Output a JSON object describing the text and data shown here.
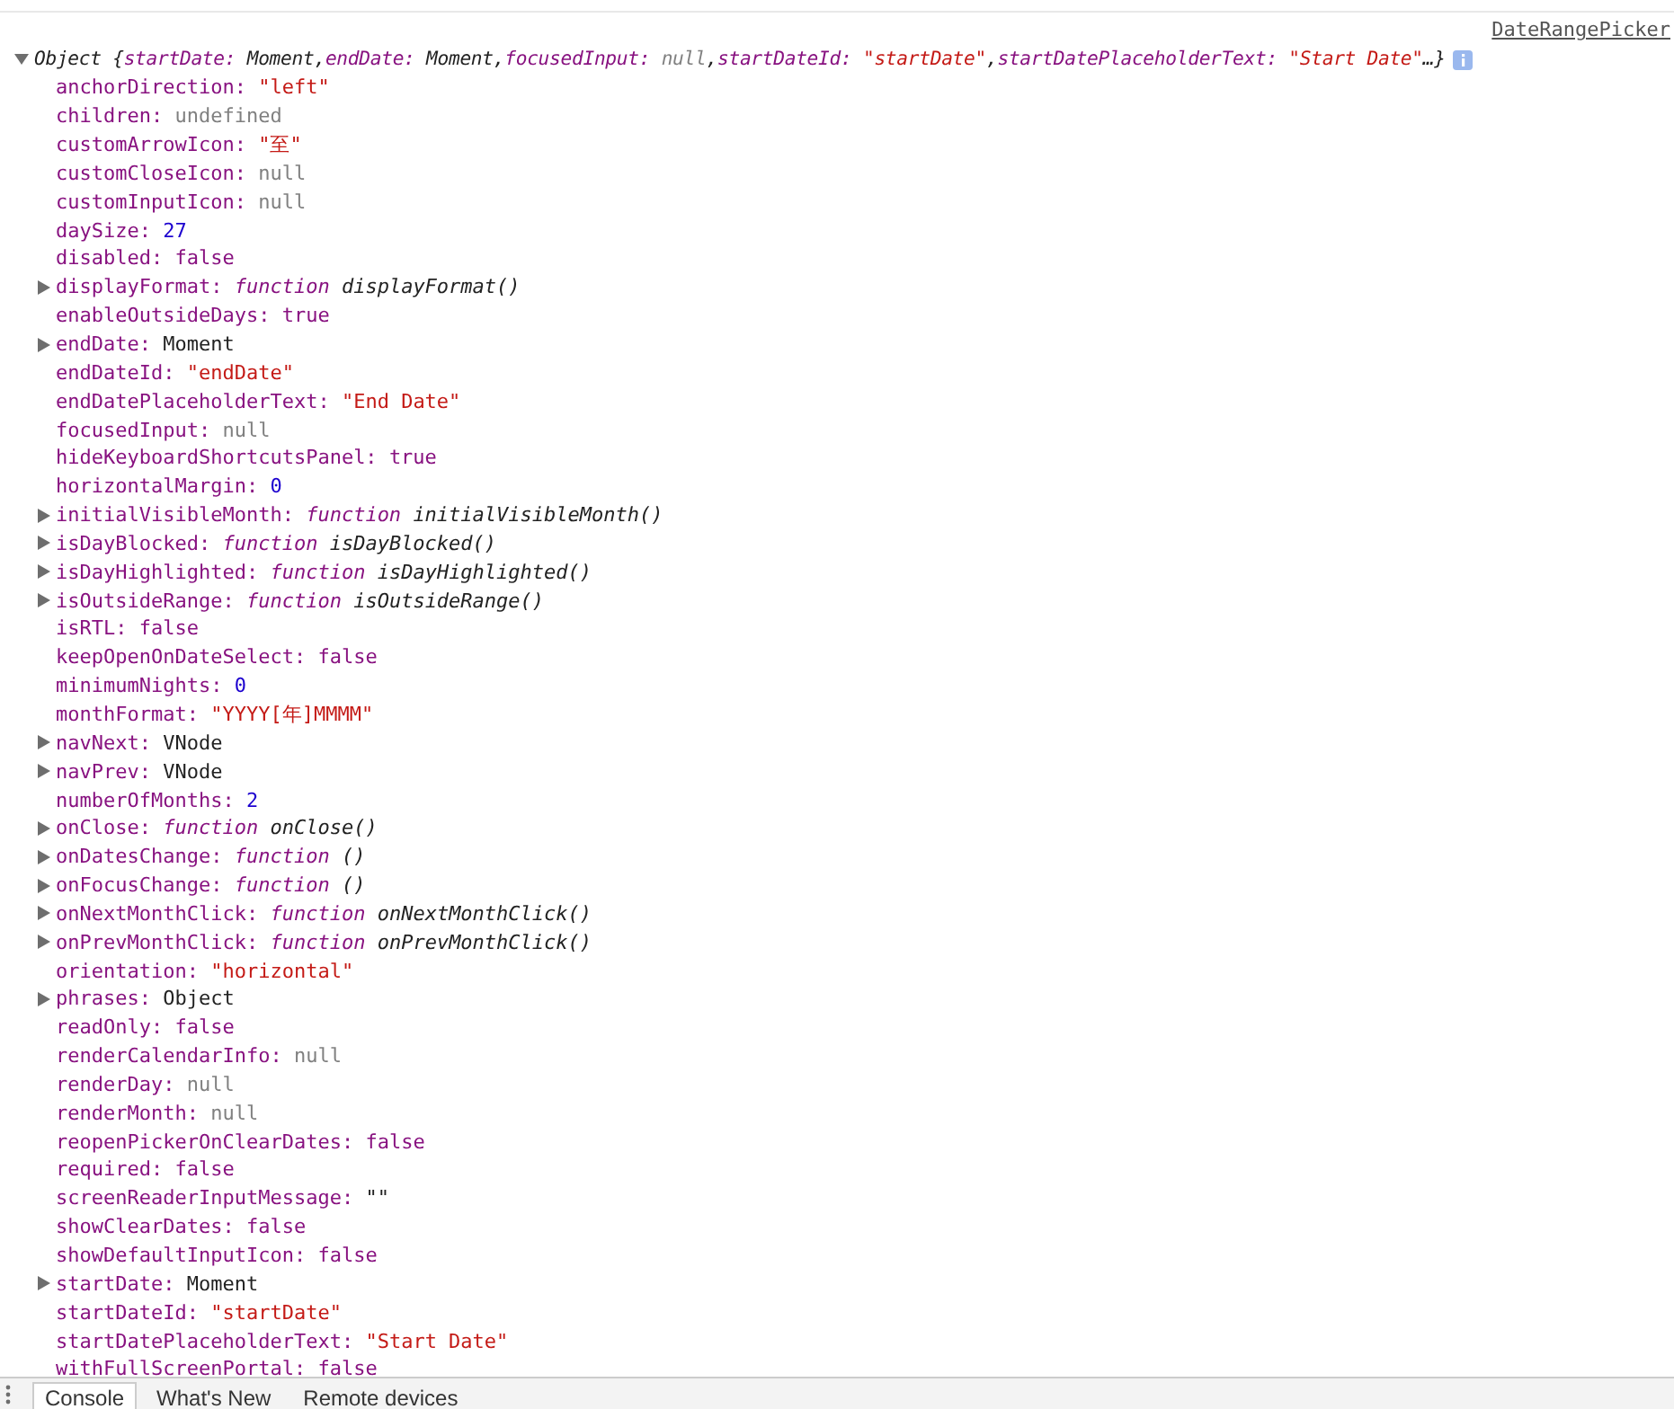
{
  "source_link": "DateRangePicker",
  "object_preview": {
    "expanded": true,
    "prefix": "Object {",
    "suffix": "…}",
    "items": [
      {
        "key": "startDate:",
        "value": "Moment",
        "kind": "object",
        "sep": ","
      },
      {
        "key": "endDate:",
        "value": "Moment",
        "kind": "object",
        "sep": ","
      },
      {
        "key": "focusedInput:",
        "value": "null",
        "kind": "null",
        "sep": ","
      },
      {
        "key": "startDateId:",
        "value": "\"startDate\"",
        "kind": "string",
        "sep": ","
      },
      {
        "key": "startDatePlaceholderText:",
        "value": "\"Start Date\"",
        "kind": "string"
      }
    ]
  },
  "properties": [
    {
      "key": "anchorDirection:",
      "value": "\"left\"",
      "kind": "string",
      "expandable": false
    },
    {
      "key": "children:",
      "value": "undefined",
      "kind": "null",
      "expandable": false
    },
    {
      "key": "customArrowIcon:",
      "value": "\"至\"",
      "kind": "string",
      "expandable": false
    },
    {
      "key": "customCloseIcon:",
      "value": "null",
      "kind": "null",
      "expandable": false
    },
    {
      "key": "customInputIcon:",
      "value": "null",
      "kind": "null",
      "expandable": false
    },
    {
      "key": "daySize:",
      "value": "27",
      "kind": "number",
      "expandable": false
    },
    {
      "key": "disabled:",
      "value": "false",
      "kind": "boolean",
      "expandable": false
    },
    {
      "key": "displayFormat:",
      "value": "displayFormat()",
      "kind": "function",
      "keyword": "function",
      "expandable": true
    },
    {
      "key": "enableOutsideDays:",
      "value": "true",
      "kind": "boolean",
      "expandable": false
    },
    {
      "key": "endDate:",
      "value": "Moment",
      "kind": "object",
      "expandable": true
    },
    {
      "key": "endDateId:",
      "value": "\"endDate\"",
      "kind": "string",
      "expandable": false
    },
    {
      "key": "endDatePlaceholderText:",
      "value": "\"End Date\"",
      "kind": "string",
      "expandable": false
    },
    {
      "key": "focusedInput:",
      "value": "null",
      "kind": "null",
      "expandable": false
    },
    {
      "key": "hideKeyboardShortcutsPanel:",
      "value": "true",
      "kind": "boolean",
      "expandable": false
    },
    {
      "key": "horizontalMargin:",
      "value": "0",
      "kind": "number",
      "expandable": false
    },
    {
      "key": "initialVisibleMonth:",
      "value": "initialVisibleMonth()",
      "kind": "function",
      "keyword": "function",
      "expandable": true
    },
    {
      "key": "isDayBlocked:",
      "value": "isDayBlocked()",
      "kind": "function",
      "keyword": "function",
      "expandable": true
    },
    {
      "key": "isDayHighlighted:",
      "value": "isDayHighlighted()",
      "kind": "function",
      "keyword": "function",
      "expandable": true
    },
    {
      "key": "isOutsideRange:",
      "value": "isOutsideRange()",
      "kind": "function",
      "keyword": "function",
      "expandable": true
    },
    {
      "key": "isRTL:",
      "value": "false",
      "kind": "boolean",
      "expandable": false
    },
    {
      "key": "keepOpenOnDateSelect:",
      "value": "false",
      "kind": "boolean",
      "expandable": false
    },
    {
      "key": "minimumNights:",
      "value": "0",
      "kind": "number",
      "expandable": false
    },
    {
      "key": "monthFormat:",
      "value": "\"YYYY[年]MMMM\"",
      "kind": "string",
      "expandable": false
    },
    {
      "key": "navNext:",
      "value": "VNode",
      "kind": "object",
      "expandable": true
    },
    {
      "key": "navPrev:",
      "value": "VNode",
      "kind": "object",
      "expandable": true
    },
    {
      "key": "numberOfMonths:",
      "value": "2",
      "kind": "number",
      "expandable": false
    },
    {
      "key": "onClose:",
      "value": "onClose()",
      "kind": "function",
      "keyword": "function",
      "expandable": true
    },
    {
      "key": "onDatesChange:",
      "value": "()",
      "kind": "function",
      "keyword": "function",
      "expandable": true
    },
    {
      "key": "onFocusChange:",
      "value": "()",
      "kind": "function",
      "keyword": "function",
      "expandable": true
    },
    {
      "key": "onNextMonthClick:",
      "value": "onNextMonthClick()",
      "kind": "function",
      "keyword": "function",
      "expandable": true
    },
    {
      "key": "onPrevMonthClick:",
      "value": "onPrevMonthClick()",
      "kind": "function",
      "keyword": "function",
      "expandable": true
    },
    {
      "key": "orientation:",
      "value": "\"horizontal\"",
      "kind": "string",
      "expandable": false
    },
    {
      "key": "phrases:",
      "value": "Object",
      "kind": "object",
      "expandable": true
    },
    {
      "key": "readOnly:",
      "value": "false",
      "kind": "boolean",
      "expandable": false
    },
    {
      "key": "renderCalendarInfo:",
      "value": "null",
      "kind": "null",
      "expandable": false
    },
    {
      "key": "renderDay:",
      "value": "null",
      "kind": "null",
      "expandable": false
    },
    {
      "key": "renderMonth:",
      "value": "null",
      "kind": "null",
      "expandable": false
    },
    {
      "key": "reopenPickerOnClearDates:",
      "value": "false",
      "kind": "boolean",
      "expandable": false
    },
    {
      "key": "required:",
      "value": "false",
      "kind": "boolean",
      "expandable": false
    },
    {
      "key": "screenReaderInputMessage:",
      "value": "\"\"",
      "kind": "plain",
      "expandable": false
    },
    {
      "key": "showClearDates:",
      "value": "false",
      "kind": "boolean",
      "expandable": false
    },
    {
      "key": "showDefaultInputIcon:",
      "value": "false",
      "kind": "boolean",
      "expandable": false
    },
    {
      "key": "startDate:",
      "value": "Moment",
      "kind": "object",
      "expandable": true
    },
    {
      "key": "startDateId:",
      "value": "\"startDate\"",
      "kind": "string",
      "expandable": false
    },
    {
      "key": "startDatePlaceholderText:",
      "value": "\"Start Date\"",
      "kind": "string",
      "expandable": false
    },
    {
      "key": "withFullScreenPortal:",
      "value": "false",
      "kind": "boolean",
      "expandable": false
    }
  ],
  "drawer_tabs": [
    {
      "label": "Console",
      "selected": true
    },
    {
      "label": "What's New",
      "selected": false
    },
    {
      "label": "Remote devices",
      "selected": false
    }
  ]
}
